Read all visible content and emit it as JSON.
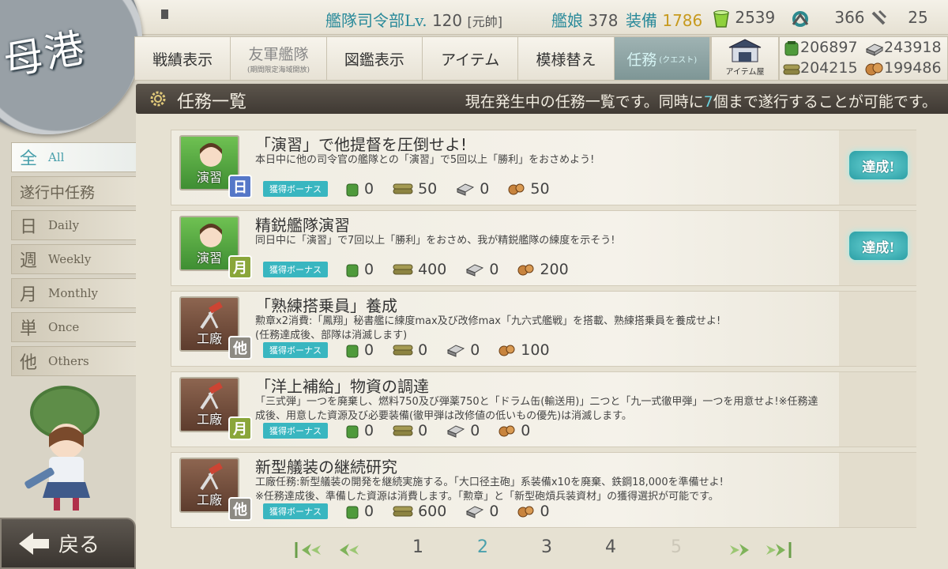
{
  "hq": {
    "label": "艦隊司令部Lv.",
    "level": "120",
    "rank": "[元帥]"
  },
  "counts": {
    "ships_label": "艦娘",
    "ships": "378",
    "equipment_label": "装備",
    "equipment": "1786",
    "bucket": "2539",
    "dev_material": "366",
    "screw": "25"
  },
  "port_emblem": {
    "text": "母港"
  },
  "nav": {
    "tabs": [
      {
        "label": "戦績表示",
        "sub": ""
      },
      {
        "label": "友軍艦隊",
        "sub": "(期間限定海域開放)"
      },
      {
        "label": "図鑑表示",
        "sub": ""
      },
      {
        "label": "アイテム",
        "sub": ""
      },
      {
        "label": "模様替え",
        "sub": ""
      },
      {
        "label": "任務",
        "sub": "(クエスト)"
      }
    ],
    "item_shop": "アイテム屋"
  },
  "resources": {
    "fuel": "206897",
    "steel": "243918",
    "ammo": "204215",
    "bauxite": "199486"
  },
  "section": {
    "title": "任務一覧",
    "desc_before": "現在発生中の任務一覧です。同時に",
    "desc_num": "7",
    "desc_after": "個まで遂行することが可能です。"
  },
  "sidebar": {
    "items": [
      {
        "big": "全",
        "label": "All"
      },
      {
        "big": "",
        "label": "遂行中任務"
      },
      {
        "big": "日",
        "label": "Daily"
      },
      {
        "big": "週",
        "label": "Weekly"
      },
      {
        "big": "月",
        "label": "Monthly"
      },
      {
        "big": "単",
        "label": "Once"
      },
      {
        "big": "他",
        "label": "Others"
      }
    ]
  },
  "back_button": {
    "label": "戻る"
  },
  "bonus_label": "獲得ボーナス",
  "complete_label": "達成!",
  "quests": [
    {
      "category": "演習",
      "freq": "日",
      "title": "「演習」で他提督を圧倒せよ!",
      "desc": "本日中に他の司令官の艦隊との「演習」で5回以上「勝利」をおさめよう!",
      "fuel": "0",
      "ammo": "50",
      "steel": "0",
      "bauxite": "50"
    },
    {
      "category": "演習",
      "freq": "月",
      "title": "精鋭艦隊演習",
      "desc": "同日中に「演習」で7回以上「勝利」をおさめ、我が精鋭艦隊の練度を示そう!",
      "fuel": "0",
      "ammo": "400",
      "steel": "0",
      "bauxite": "200"
    },
    {
      "category": "工廠",
      "freq": "他",
      "title": "「熟練搭乗員」養成",
      "desc": "勲章x2消費:「鳳翔」秘書艦に練度max及び改修max「九六式艦戦」を搭載、熟練搭乗員を養成せよ!\n(任務達成後、部隊は消滅します)",
      "fuel": "0",
      "ammo": "0",
      "steel": "0",
      "bauxite": "100"
    },
    {
      "category": "工廠",
      "freq": "月",
      "title": "「洋上補給」物資の調達",
      "desc": "「三式弾」一つを廃棄し、燃料750及び弾薬750と「ドラム缶(輸送用)」二つと「九一式徹甲弾」一つを用意せよ!※任務達成後、用意した資源及び必要装備(徹甲弾は改修値の低いもの優先)は消滅します。",
      "fuel": "0",
      "ammo": "0",
      "steel": "0",
      "bauxite": "0"
    },
    {
      "category": "工廠",
      "freq": "他",
      "title": "新型艤装の継続研究",
      "desc": "工廠任務:新型艤装の開発を継続実施する。「大口径主砲」系装備x10を廃棄、鉄鋼18,000を準備せよ!\n※任務達成後、準備した資源は消費します。「勲章」と「新型砲熕兵装資材」の獲得選択が可能です。",
      "fuel": "0",
      "ammo": "600",
      "steel": "0",
      "bauxite": "0"
    }
  ],
  "pagination": {
    "pages": [
      "1",
      "2",
      "3",
      "4",
      "5"
    ],
    "current": "2"
  }
}
